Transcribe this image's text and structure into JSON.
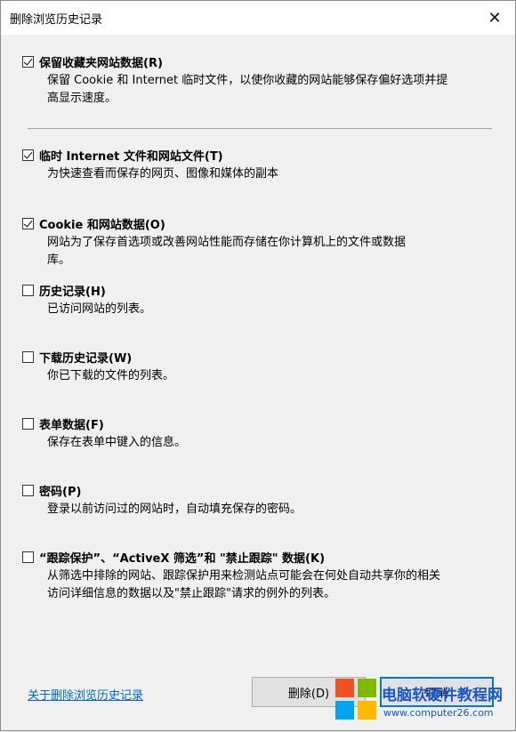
{
  "window": {
    "title": "删除浏览历史记录",
    "close_glyph": "✕"
  },
  "options": [
    {
      "label": "保留收藏夹网站数据(R)",
      "checked": true,
      "desc": [
        "保留 Cookie 和 Internet 临时文件，以使你收藏的网站能够保存偏好选项并提",
        "高显示速度。"
      ]
    },
    {
      "label": "临时 Internet 文件和网站文件(T)",
      "checked": true,
      "desc": [
        "为快速查看而保存的网页、图像和媒体的副本"
      ]
    },
    {
      "label": "Cookie 和网站数据(O)",
      "checked": true,
      "desc": [
        "网站为了保存首选项或改善网站性能而存储在你计算机上的文件或数据",
        "库。"
      ]
    },
    {
      "label": "历史记录(H)",
      "checked": false,
      "desc": [
        "已访问网站的列表。"
      ]
    },
    {
      "label": "下载历史记录(W)",
      "checked": false,
      "desc": [
        "你已下载的文件的列表。"
      ]
    },
    {
      "label": "表单数据(F)",
      "checked": false,
      "desc": [
        "保存在表单中键入的信息。"
      ]
    },
    {
      "label": "密码(P)",
      "checked": false,
      "desc": [
        "登录以前访问过的网站时，自动填充保存的密码。"
      ]
    },
    {
      "label": "“跟踪保护”、“ActiveX 筛选”和 \"禁止跟踪\" 数据(K)",
      "checked": false,
      "desc": [
        "从筛选中排除的网站、跟踪保护用来检测站点可能会在何处自动共享你的相关",
        "访问详细信息的数据以及\"禁止跟踪\"请求的例外的列表。"
      ]
    }
  ],
  "footer": {
    "about_link": "关于删除浏览历史记录",
    "delete_button": "删除(D)",
    "cancel_button": "取消"
  },
  "watermark": {
    "title": "电脑软硬件教程网",
    "url": "www.computer26.com",
    "colors": [
      "#f25022",
      "#7fba00",
      "#00a4ef",
      "#ffb900"
    ]
  }
}
